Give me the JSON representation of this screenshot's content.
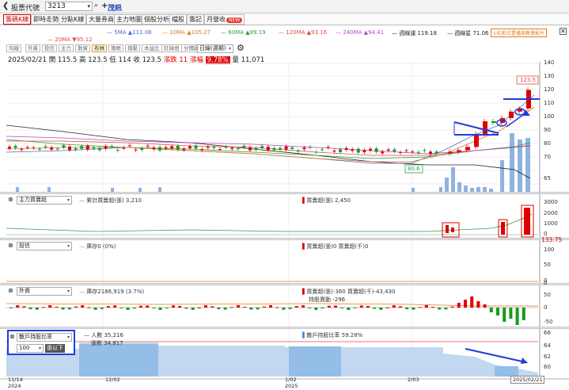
{
  "topbar": {
    "back_icon": "chevron-left-icon",
    "stock_code_label": "股票代號",
    "stock_code_value": "3213",
    "search_icon": "magnifier-icon",
    "add_icon": "plus-icon",
    "stock_name": "茂訊"
  },
  "tabs": [
    {
      "label": "籌碼K線",
      "active": true
    },
    {
      "label": "即時走勢",
      "active": false
    },
    {
      "label": "分點K線",
      "active": false
    },
    {
      "label": "大量券商",
      "active": false
    },
    {
      "label": "主力地圖",
      "active": false
    },
    {
      "label": "個股分析",
      "active": false
    },
    {
      "label": "檔股",
      "active": false
    },
    {
      "label": "籌記",
      "active": false
    },
    {
      "label": "月營收",
      "active": false,
      "badge": "NEW"
    }
  ],
  "ma_row": [
    {
      "label": "5MA ▲111.08",
      "color": "#4a6cd4"
    },
    {
      "label": "10MA ▲105.27",
      "color": "#e07a1f"
    },
    {
      "label": "60MA ▲89.19",
      "color": "#2e9e45"
    },
    {
      "label": "120MA ▲93.16",
      "color": "#e04a4a"
    },
    {
      "label": "240MA ▲94.41",
      "color": "#b04ad0"
    },
    {
      "label": "週線濾 119.18",
      "color": "#333333"
    },
    {
      "label": "週線星 71.06",
      "color": "#333333"
    },
    {
      "label": "⊙扣抵位置播放教學影片",
      "color": "#e07a1f"
    }
  ],
  "ma_row2": {
    "label": "20MA ▼95.12",
    "color": "#e04a4a"
  },
  "toolbar": [
    "均線",
    "外資",
    "投信",
    "主力",
    "散資",
    "布林",
    "籌帳",
    "撐壓",
    "本益比",
    "紅綠燈",
    "分價圖"
  ],
  "toolbar_active": "布林",
  "period_select": "日線(週期)",
  "quote": {
    "date": "2025/02/21",
    "open_label": "開",
    "open": "115.5",
    "high_label": "高",
    "high": "123.5",
    "low_label": "低",
    "low": "114",
    "close_label": "收",
    "close": "123.5",
    "change_label": "漲跌",
    "change": "11",
    "pct_label": "漲幅",
    "pct": "9.78%",
    "vol_label": "量",
    "vol": "11,071"
  },
  "price_axis": [
    "140",
    "135",
    "130",
    "125",
    "120",
    "115",
    "110",
    "105",
    "100",
    "95",
    "90",
    "85",
    "80",
    "75",
    "70",
    "65"
  ],
  "price_annotations": {
    "high": "123.5",
    "low": "80.6"
  },
  "chart_data": {
    "type": "candlestick",
    "x_ticks": [
      "11/14\n2024",
      "12/02",
      "1/02\n2025",
      "2/03",
      "2025/02/21"
    ],
    "ylim": [
      62,
      142
    ],
    "recent_closes": [
      85,
      86,
      88,
      96,
      104,
      103,
      106,
      110,
      112,
      123.5
    ],
    "volume_recent": [
      8,
      18,
      7,
      6,
      4,
      30,
      60,
      95,
      95
    ]
  },
  "panel_main_force": {
    "select": "主力買賣超",
    "legend1": "累計買賣超(張) 3,210",
    "legend2": "買賣超(張) 2,450",
    "axis": [
      "3000",
      "2000",
      "1000",
      "0"
    ]
  },
  "panel_trust": {
    "select": "投信",
    "legend1": "庫存0 (0%)",
    "legend2": "買賣超(張)0 買賣超(千)0",
    "axis": [
      "133.75",
      "100",
      "50",
      "0"
    ]
  },
  "panel_foreign": {
    "select": "外資",
    "legend1": "庫存2186,919 (3.7%)",
    "legend2": "買賣超(張)-360 買賣超(千)-43,430",
    "legend3": "持股異動 -296",
    "axis": [
      "0",
      "50",
      "0",
      "-50"
    ]
  },
  "panel_holders": {
    "select": "散戶持股比率",
    "select2": "100",
    "select2_suffix": "張以下",
    "legend1": "人數 35,216",
    "legend2": "張數 34,817",
    "legend3": "散戶持股比率 59.28%",
    "axis": [
      "66",
      "64",
      "62",
      "60"
    ]
  },
  "x_axis": [
    {
      "l1": "11/14",
      "l2": "2024"
    },
    {
      "l1": "12/02",
      "l2": ""
    },
    {
      "l1": "1/02",
      "l2": "2025"
    },
    {
      "l1": "2/03",
      "l2": ""
    },
    {
      "l1": "2025/02/21",
      "l2": ""
    }
  ],
  "colors": {
    "up": "#e00000",
    "down": "#1a9a1a",
    "volume": "#7fa7d6",
    "accent_blue": "#1e3fd8"
  }
}
